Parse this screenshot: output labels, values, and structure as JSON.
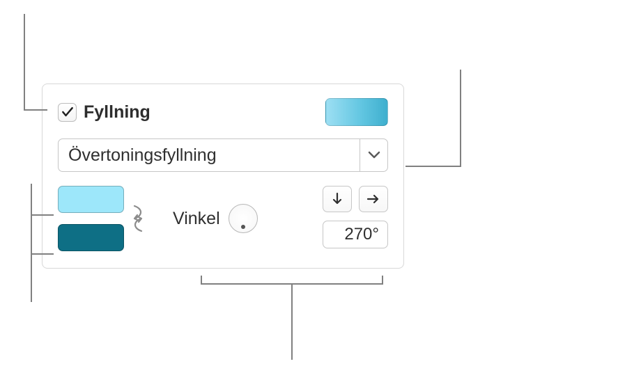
{
  "fill": {
    "checkbox_checked": true,
    "label": "Fyllning",
    "preview_gradient": [
      "#9ddff3",
      "#3eafce"
    ]
  },
  "fill_type": {
    "selected": "Övertoningsfyllning"
  },
  "gradient": {
    "color_a": "#9de7fa",
    "color_b": "#0e6f85",
    "angle_label": "Vinkel",
    "angle_value": "270°"
  },
  "icons": {
    "check": "check-icon",
    "chevron_down": "chevron-down-icon",
    "swap": "swap-icon",
    "arrow_down": "arrow-down-icon",
    "arrow_right": "arrow-right-icon"
  }
}
